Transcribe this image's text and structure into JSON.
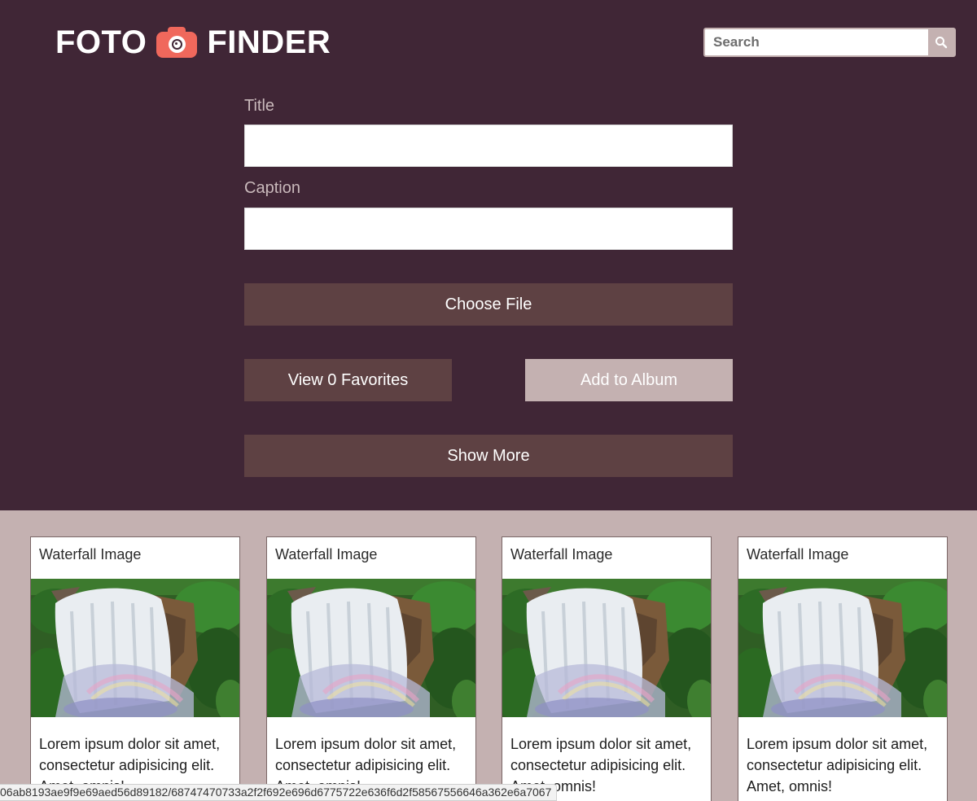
{
  "brand": {
    "word_left": "FOTO",
    "word_right": "FINDER",
    "logo_icon": "camera-icon"
  },
  "search": {
    "placeholder": "Search",
    "icon": "search-icon"
  },
  "form": {
    "title_label": "Title",
    "title_value": "",
    "caption_label": "Caption",
    "caption_value": "",
    "choose_file_label": "Choose File",
    "view_favorites_label": "View 0 Favorites",
    "add_to_album_label": "Add to Album",
    "show_more_label": "Show More"
  },
  "colors": {
    "header_bg": "#402636",
    "page_bg": "#c4b1b1",
    "button_dark": "#5e4143",
    "button_light": "#c4b1b1",
    "logo_accent": "#f0685c"
  },
  "cards": [
    {
      "title": "Waterfall Image",
      "body": "Lorem ipsum dolor sit amet, consectetur adipisicing elit. Amet, omnis!"
    },
    {
      "title": "Waterfall Image",
      "body": "Lorem ipsum dolor sit amet, consectetur adipisicing elit. Amet, omnis!"
    },
    {
      "title": "Waterfall Image",
      "body": "Lorem ipsum dolor sit amet, consectetur adipisicing elit. Amet, omnis!"
    },
    {
      "title": "Waterfall Image",
      "body": "Lorem ipsum dolor sit amet, consectetur adipisicing elit. Amet, omnis!"
    }
  ],
  "status_bar": {
    "url": "06ab8193ae9f9e69aed56d89182/68747470733a2f2f692e696d6775722e636f6d2f58567556646a362e6a7067"
  }
}
